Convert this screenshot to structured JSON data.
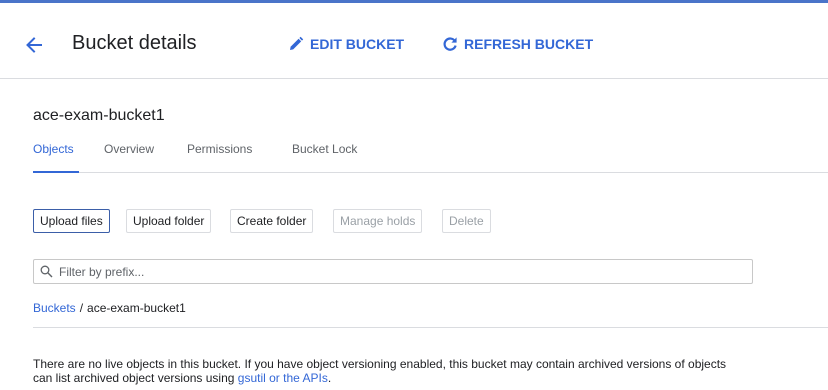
{
  "header": {
    "title": "Bucket details",
    "edit_label": "EDIT BUCKET",
    "refresh_label": "REFRESH BUCKET"
  },
  "bucket": {
    "name": "ace-exam-bucket1"
  },
  "tabs": [
    {
      "label": "Objects",
      "active": true
    },
    {
      "label": "Overview",
      "active": false
    },
    {
      "label": "Permissions",
      "active": false
    },
    {
      "label": "Bucket Lock",
      "active": false
    }
  ],
  "toolbar": {
    "upload_files": "Upload files",
    "upload_folder": "Upload folder",
    "create_folder": "Create folder",
    "manage_holds": "Manage holds",
    "delete": "Delete"
  },
  "filter": {
    "placeholder": "Filter by prefix...",
    "value": ""
  },
  "breadcrumb": {
    "root": "Buckets",
    "separator": "/",
    "current": "ace-exam-bucket1"
  },
  "empty_message": {
    "line1": "There are no live objects in this bucket. If you have object versioning enabled, this bucket may contain archived versions of objects",
    "line2_prefix": "can list archived object versions using ",
    "line2_link": "gsutil or the APIs",
    "line2_suffix": "."
  },
  "icons": {
    "back": "arrow-left-icon",
    "edit": "pencil-icon",
    "refresh": "refresh-icon",
    "filter": "search-icon"
  },
  "colors": {
    "accent": "#3367d6",
    "top_bar": "#4a74c9",
    "divider": "#dadce0",
    "disabled_text": "#9aa0a6"
  }
}
